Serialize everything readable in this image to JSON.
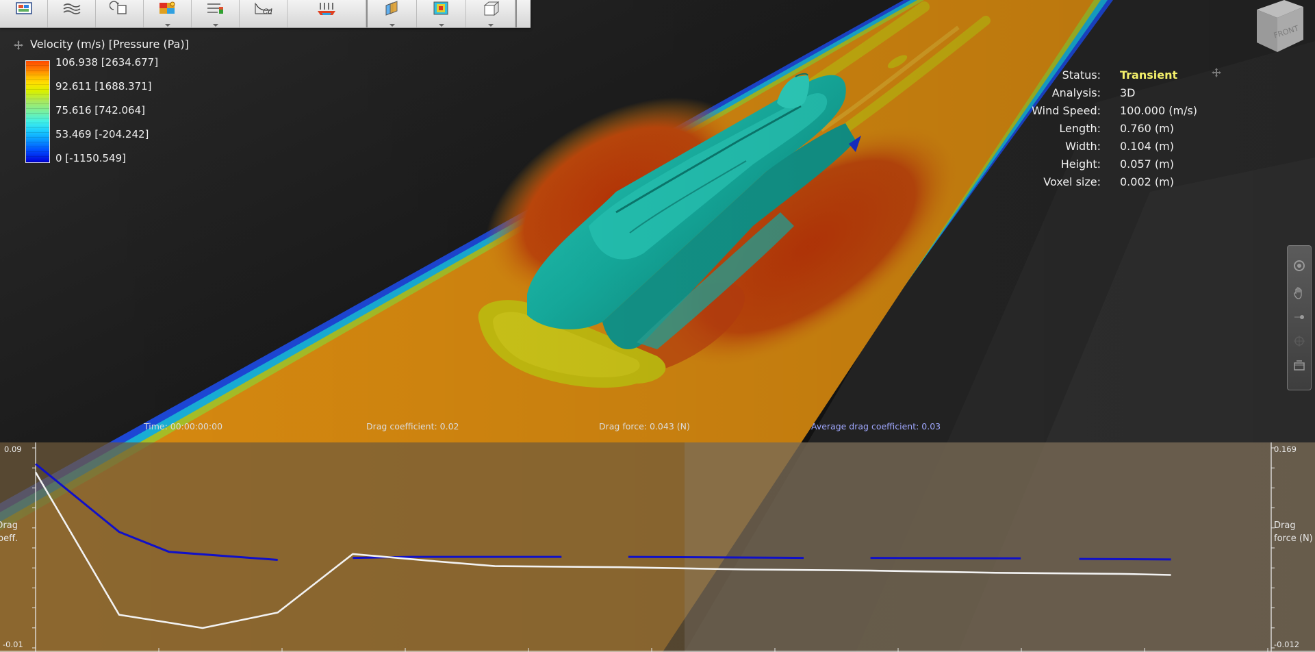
{
  "toolbar": {
    "groups": [
      [
        {
          "icon": "results-display-icon",
          "caret": false
        },
        {
          "icon": "wind-flow-icon",
          "caret": false
        },
        {
          "icon": "rotate-object-icon",
          "caret": false
        },
        {
          "icon": "color-plot-settings-icon",
          "caret": true
        },
        {
          "icon": "legend-settings-icon",
          "caret": true
        },
        {
          "icon": "drag-coefficient-chart-icon",
          "caret": false
        },
        {
          "icon": "wind-direction-icon",
          "caret": false
        }
      ],
      [
        {
          "icon": "slice-planes-icon",
          "caret": true
        },
        {
          "icon": "surface-pressure-icon",
          "caret": true
        },
        {
          "icon": "box-view-icon",
          "caret": true
        }
      ]
    ]
  },
  "legend": {
    "title": "Velocity (m/s) [Pressure (Pa)]",
    "labels": [
      "106.938 [2634.677]",
      "92.611 [1688.371]",
      "75.616 [742.064]",
      "53.469 [-204.242]",
      "0 [-1150.549]"
    ]
  },
  "info": {
    "rows": [
      {
        "key": "Status:",
        "value": "Transient"
      },
      {
        "key": "Analysis:",
        "value": "3D"
      },
      {
        "key": "Wind Speed:",
        "value": "100.000 (m/s)"
      },
      {
        "key": "Length:",
        "value": "0.760 (m)"
      },
      {
        "key": "Width:",
        "value": "0.104 (m)"
      },
      {
        "key": "Height:",
        "value": "0.057 (m)"
      },
      {
        "key": "Voxel size:",
        "value": "0.002 (m)"
      }
    ]
  },
  "navcube": {
    "label": "FRONT"
  },
  "status_line": {
    "time": "Time: 00:00:00:00",
    "drag_coefficient": "Drag coefficient: 0.02",
    "drag_force": "Drag force: 0.043 (N)",
    "average_drag_coefficient": "Average drag coefficient: 0.03"
  },
  "chart_data": {
    "type": "line",
    "left_axis": {
      "label_lines": [
        "Drag",
        "coeff."
      ],
      "max_label": "0.09",
      "min_label": "-0.01",
      "ylim": [
        -0.01,
        0.09
      ]
    },
    "right_axis": {
      "label_lines": [
        "Drag",
        "force (N)"
      ],
      "max_label": "0.169",
      "min_label": "-0.012",
      "ylim": [
        -0.012,
        0.169
      ]
    },
    "x_ticks": 10,
    "series": [
      {
        "axis": "left",
        "color": "#1010c8",
        "segments": [
          [
            [
              0.0,
              0.082
            ],
            [
              1.0,
              0.048
            ],
            [
              1.6,
              0.038
            ],
            [
              2.9,
              0.034
            ]
          ],
          [
            [
              3.8,
              0.035
            ],
            [
              4.5,
              0.0355
            ],
            [
              6.3,
              0.0355
            ]
          ],
          [
            [
              7.1,
              0.0355
            ],
            [
              9.2,
              0.035
            ]
          ],
          [
            [
              10.0,
              0.035
            ],
            [
              11.8,
              0.0348
            ]
          ],
          [
            [
              12.5,
              0.0345
            ],
            [
              13.6,
              0.0342
            ]
          ]
        ]
      },
      {
        "axis": "right",
        "color": "#f2f2f2",
        "segments": [
          [
            [
              0.0,
              0.147
            ],
            [
              1.0,
              0.018
            ],
            [
              2.0,
              0.006
            ],
            [
              2.9,
              0.02
            ],
            [
              3.8,
              0.073
            ],
            [
              4.7,
              0.067
            ],
            [
              5.5,
              0.062
            ],
            [
              7.0,
              0.061
            ],
            [
              8.5,
              0.059
            ],
            [
              10.0,
              0.058
            ],
            [
              11.5,
              0.056
            ],
            [
              13.0,
              0.055
            ],
            [
              13.6,
              0.054
            ]
          ]
        ]
      }
    ],
    "x_range": [
      0,
      14.8
    ]
  },
  "colors": {
    "channel_core": "#d88a10",
    "wake": "#b8400c",
    "ship": "#1bb5a6",
    "ground_glow": "#c8c010",
    "chart_bg": "#6f5a3c"
  }
}
